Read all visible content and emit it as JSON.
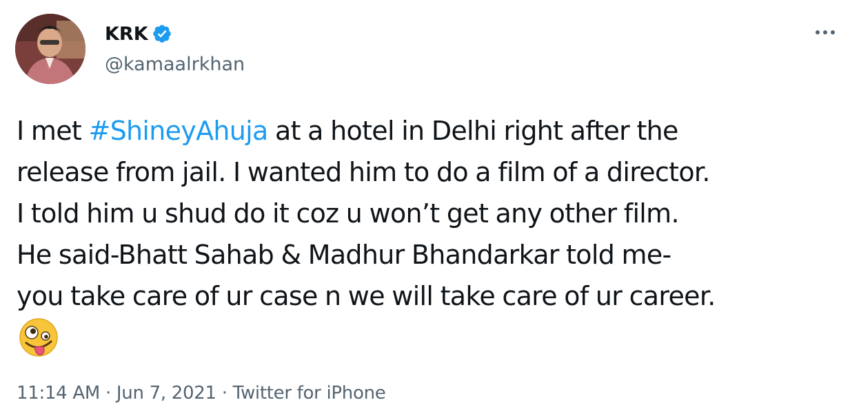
{
  "author": {
    "display_name": "KRK",
    "handle": "@kamaalrkhan",
    "verified": true,
    "verified_color": "#1d9bf0"
  },
  "tweet": {
    "lines": [
      {
        "before": "I met ",
        "hashtag": "#ShineyAhuja",
        "after": " at a hotel in Delhi right after the"
      },
      {
        "text": "release from jail. I wanted him to do a film of a director."
      },
      {
        "text": "I told him u shud do it coz u won’t get any other film."
      },
      {
        "text": "He said-Bhatt Sahab & Madhur Bhandarkar told me-"
      },
      {
        "text": "you take care of ur case n we will take care of ur career."
      }
    ],
    "emoji": "zany-face-emoji",
    "hashtag_color": "#1d9bf0"
  },
  "meta": {
    "time": "11:14 AM",
    "separator": "·",
    "date": "Jun 7, 2021",
    "source": "Twitter for iPhone"
  },
  "icons": {
    "more": "more-dots-icon",
    "verified": "verified-badge-icon"
  }
}
